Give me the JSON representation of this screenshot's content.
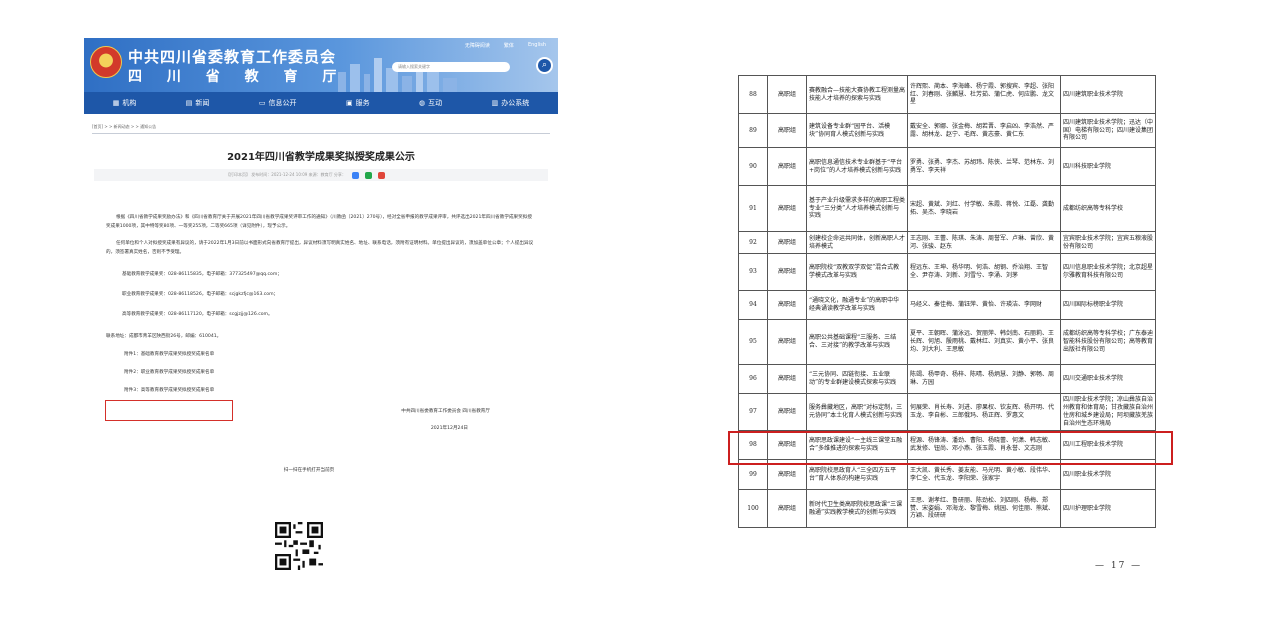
{
  "left": {
    "header": {
      "title": "中共四川省委教育工作委员会",
      "subtitle": "四 川 省 教 育 厅",
      "top_links": [
        "无障碍阅读",
        "繁体",
        "English"
      ],
      "search_placeholder": "请输入搜索关键字"
    },
    "nav": [
      {
        "icon": "building-icon",
        "glyph": "▦",
        "label": "机构"
      },
      {
        "icon": "news-icon",
        "glyph": "▤",
        "label": "新闻"
      },
      {
        "icon": "info-icon",
        "glyph": "▭",
        "label": "信息公开"
      },
      {
        "icon": "service-icon",
        "glyph": "▣",
        "label": "服务"
      },
      {
        "icon": "interact-icon",
        "glyph": "◍",
        "label": "互动"
      },
      {
        "icon": "office-icon",
        "glyph": "▥",
        "label": "办公系统"
      }
    ],
    "breadcrumb": "[首页] > > 新闻动态 > > 通知公告",
    "article": {
      "title": "2021年四川省教学成果奖拟授奖成果公示",
      "meta": "【打印本页】 发布时间：2021-12-24 10:09 来源：教育厅 分享：",
      "para1": "根据《四川省教学成果奖励办法》和《四川省教育厅关于开展2021年四川省教学成果奖评审工作的通知》（川教函〔2021〕270号），经对全省申报的教学成果评审，共评选出2021年四川省教学成果奖拟授奖成果1000项，其中特等奖80项、一等奖255项，二等奖665项（详见附件），现予公示。",
      "para2": "任何单位和个人对拟授奖成果有异议的，请于2022年1月3日前以书面形式向省教育厅提出，异议材料须写明真实姓名、地址、联系电话，须附有证明材料。单位提出异议的，须加盖单位公章；个人提出异议的，须签署真实姓名，否则不予受理。",
      "contacts": [
        "基础教育教学成果奖：028-86115835，电子邮箱：377325497@qq.com；",
        "职业教育教学成果奖：028-86118526，电子邮箱：scjgkzfjc@163.com；",
        "高等教育教学成果奖：028-86117120，电子邮箱：scgjzjj@126.com。"
      ],
      "address": "联系地址：成都市青羊区陕西街26号，邮编：610041。",
      "attachments": [
        "附件1：基础教育教学成果奖拟授奖成果名单",
        "附件2：职业教育教学成果奖拟授奖成果名单",
        "附件3：高等教育教学成果奖拟授奖成果名单"
      ],
      "signer": "中共四川省委教育工作委员会 四川省教育厅",
      "date": "2021年12月24日",
      "qr_caption": "扫一扫在手机打开当前页"
    }
  },
  "right": {
    "page_number": "— 17 —",
    "rows": [
      {
        "num": "88",
        "group": "高职组",
        "title": "赛教融合—技能大赛协教工程测量高技能人才培养的探索与实践",
        "members": "许辉熙、蔺本、李海峰、杨宁霞、郭搜宾、李超、张阳红、刘春刚、张麟慧、杜芳茹、蒲仁虎、何应鹏、龙文星",
        "unit": "四川建筑职业技术学院"
      },
      {
        "num": "89",
        "group": "高职组",
        "title": "建筑设备专业群“园平台、活模块”协同育人模式创新与实践",
        "members": "戴安全、郭娜、张金梅、胡若晋、李启凶、李浩然、严露、胡林龙、赵宁、毛辉、黄志豪、黄仁东",
        "unit": "四川建筑职业技术学院；迅达（中国）电梯有限公司；四川建设集团有限公司"
      },
      {
        "num": "90",
        "group": "高职组",
        "title": "高职信息通信技术专业群基于“平台+岗位”的人才培养模式创新与实践",
        "members": "罗勇、张勇、李杰、苏胡玮、陈侠、兰琴、范林东、刘勇军、李天祥",
        "unit": "四川科技职业学院"
      },
      {
        "num": "91",
        "group": "高职组",
        "title": "基于产业升级需求多样的高职工程类专业“三分类”人才培养模式创新与实践",
        "members": "宋超、黄斌、刘红、付学敏、朱霞、蒋悦、江磊、龚勤拓、吴杰、李晓岩",
        "unit": "成都纺织高等专科学校"
      },
      {
        "num": "92",
        "group": "高职组",
        "title": "创建校企命运共同体，创新高职人才培养模式",
        "members": "王志刚、王蕾、陈琪、朱涛、周誉军、卢琳、曾欣、黄河、张骏、赵东",
        "unit": "宜宾职业技术学院；宜宾五粮液股份有限公司"
      },
      {
        "num": "93",
        "group": "高职组",
        "title": "高职院校“双教双学双促”混合式教学模式改革与实践",
        "members": "程远东、王坤、杨华明、何浩、胡钢、乔治翔、王智全、尹存涛、刘新、刘雪兮、李涌、刘茅",
        "unit": "四川信息职业技术学院；北京超星尔雅教育科技有限公司"
      },
      {
        "num": "94",
        "group": "高职组",
        "title": "“通晓文化，融通专业”的高职中华经典诵读教学改革与实践",
        "members": "马经义、秦佳梅、蒲钰萍、黄怡、许瑛洁、李网财",
        "unit": "四川国际标榜职业学院"
      },
      {
        "num": "95",
        "group": "高职组",
        "title": "高职公共基础课程“三服务、三结合、三对接”的教学改革与实践",
        "members": "夏平、王朝晖、蒲泳远、贺丽萍、韩剑南、石丽莉、王长辉、何旭、殷雨桃、戴林红、刘真实、黄小平、张良均、刘大利、王思敏",
        "unit": "成都纺织高等专科学校；广东泰迪智能科技股份有限公司；高等教育出版社有限公司"
      },
      {
        "num": "96",
        "group": "高职组",
        "title": "“三元协同、四链衔接、五业联动”的专业群建设模式探索与实践",
        "members": "陈竭、杨甲奇、杨梓、陈晴、杨炳慧、刘静、郭畅、周琳、方园",
        "unit": "四川交通职业技术学院"
      },
      {
        "num": "97",
        "group": "高职组",
        "title": "服务彝藏地区，高职“对标定制，三元协同”本土化育人模式创新与实践",
        "members": "何展荣、肖长寿、刘进、廖果权、钦友辉、杨开明、代玉龙、李自彬、三郎俄玛、杨正辉、罗惠文",
        "unit": "四川职业技术学院；凉山彝族自治州教育和体育局；甘孜藏族自治州住房和城乡建设局；阿坝藏族羌族自治州生态环境局"
      },
      {
        "num": "98",
        "group": "高职组",
        "title": "高职思政课建设“一主线三课堂五融合”多维推进的探索与实践",
        "members": "程源、杨锋涛、潘劲、曹阳、杨晓蕾、何潇、韩志敏、武发修、钮尚、邓小燕、张玉霞、肖永誉、文志刚",
        "unit": "四川工程职业技术学院"
      },
      {
        "num": "99",
        "group": "高职组",
        "title": "高职院校思政育人“三全四方五平台”育人体系的构建与实践",
        "members": "王大凯、黄长秀、姜友能、马光明、黄小敏、段伟华、李仁全、代玉龙、李阳荣、张家宇",
        "unit": "四川职业技术学院"
      },
      {
        "num": "100",
        "group": "高职组",
        "title": "新时代卫生类高职院校思政课“三课融通”实践教学模式的创新与实践",
        "members": "王思、谢孝红、鲁研丽、陈劲松、刘四刚、杨梅、郑赞、宋姿娟、邓海龙、黎雪梅、姚园、何佳丽、熊斌、方颖、段研研",
        "unit": "四川护理职业学院"
      }
    ]
  },
  "colors": {
    "header_blue": "#1e57a8",
    "highlight_red": "#cc1f1f",
    "attachment_box_red": "#d4302a"
  }
}
